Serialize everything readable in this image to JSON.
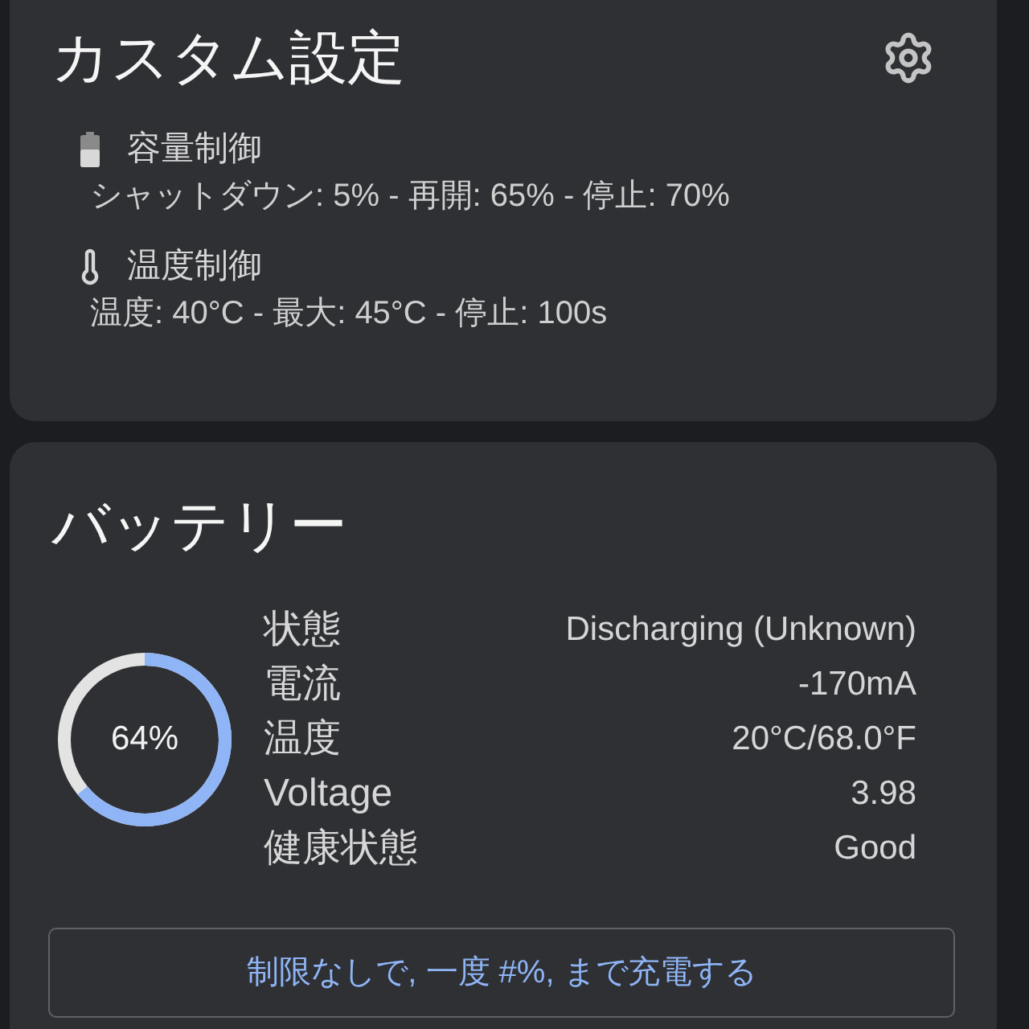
{
  "custom_settings": {
    "title": "カスタム設定",
    "sections": [
      {
        "kind": "capacity",
        "label": "容量制御",
        "detail": "シャットダウン: 5% - 再開: 65% - 停止: 70%"
      },
      {
        "kind": "temperature",
        "label": "温度制御",
        "detail": "温度: 40°C - 最大: 45°C - 停止: 100s"
      }
    ]
  },
  "battery": {
    "title": "バッテリー",
    "charge": {
      "level": 0.64,
      "reading": "64%"
    },
    "details": [
      {
        "label": "状態",
        "value": "Discharging (Unknown)"
      },
      {
        "label": "電流",
        "value": "-170mA"
      },
      {
        "label": "温度",
        "value": "20°C/68.0°F"
      },
      {
        "label": "Voltage",
        "value": "3.98"
      },
      {
        "label": "健康状態",
        "value": "Good"
      }
    ],
    "charge_button": "制限なしで, 一度 #%, まで充電する"
  }
}
